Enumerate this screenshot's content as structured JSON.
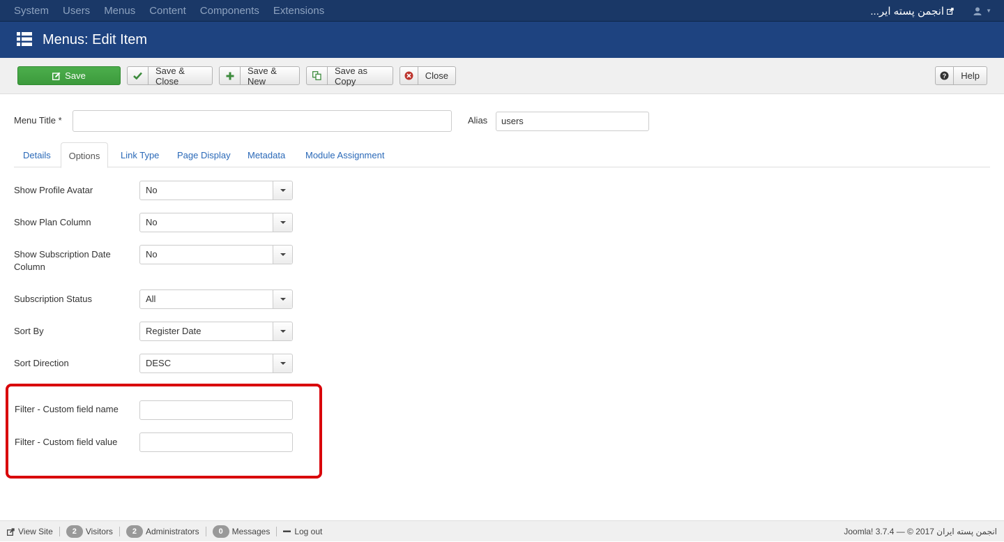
{
  "topnav": {
    "menu": [
      "System",
      "Users",
      "Menus",
      "Content",
      "Components",
      "Extensions"
    ],
    "site_name": "انجمن پسته ایر..."
  },
  "header": {
    "title": "Menus: Edit Item"
  },
  "toolbar": {
    "save": "Save",
    "save_close": "Save & Close",
    "save_new": "Save & New",
    "save_copy": "Save as Copy",
    "close": "Close",
    "help": "Help"
  },
  "form": {
    "menu_title_label": "Menu Title *",
    "menu_title_value": "",
    "alias_label": "Alias",
    "alias_value": "users"
  },
  "tabs": [
    "Details",
    "Options",
    "Link Type",
    "Page Display",
    "Metadata",
    "Module Assignment"
  ],
  "active_tab": "Options",
  "options": [
    {
      "label": "Show Profile Avatar",
      "value": "No"
    },
    {
      "label": "Show Plan Column",
      "value": "No"
    },
    {
      "label": "Show Subscription Date Column",
      "value": "No"
    },
    {
      "label": "Subscription Status",
      "value": "All"
    },
    {
      "label": "Sort By",
      "value": "Register Date"
    },
    {
      "label": "Sort Direction",
      "value": "DESC"
    }
  ],
  "filters": [
    {
      "label": "Filter - Custom field name",
      "value": ""
    },
    {
      "label": "Filter - Custom field value",
      "value": ""
    }
  ],
  "status": {
    "view_site": "View Site",
    "visitors_count": "2",
    "visitors": "Visitors",
    "admins_count": "2",
    "admins": "Administrators",
    "messages_count": "0",
    "messages": "Messages",
    "logout": "Log out",
    "copyright": "Joomla! 3.7.4 — © 2017 انجمن پسته ایران"
  },
  "colors": {
    "navbar": "#1a3867",
    "header": "#1e4380",
    "save_green": "#46a546",
    "highlight_red": "#d9040a",
    "link_blue": "#2a69b8"
  }
}
